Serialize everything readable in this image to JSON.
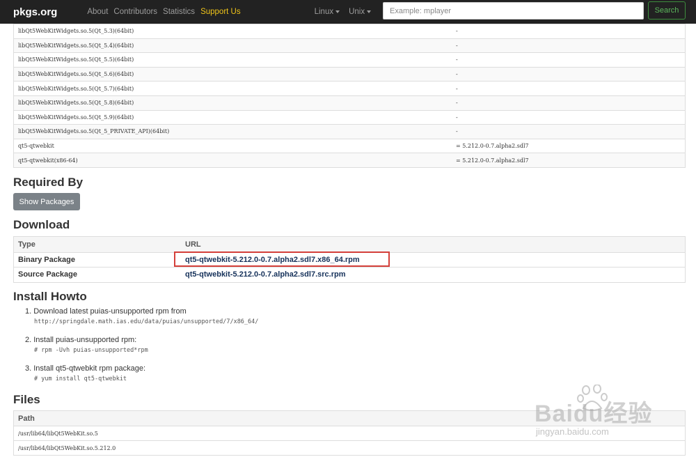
{
  "navbar": {
    "brand": "pkgs.org",
    "links": [
      "About",
      "Contributors",
      "Statistics",
      "Support Us"
    ],
    "dropdowns": [
      "Linux",
      "Unix"
    ],
    "search_placeholder": "Example: mplayer",
    "search_button": "Search",
    "support_color": "#f0c419"
  },
  "provides": [
    {
      "name": "libQt5WebKitWidgets.so.5(Qt_5.3)(64bit)",
      "version": "-"
    },
    {
      "name": "libQt5WebKitWidgets.so.5(Qt_5.4)(64bit)",
      "version": "-"
    },
    {
      "name": "libQt5WebKitWidgets.so.5(Qt_5.5)(64bit)",
      "version": "-"
    },
    {
      "name": "libQt5WebKitWidgets.so.5(Qt_5.6)(64bit)",
      "version": "-"
    },
    {
      "name": "libQt5WebKitWidgets.so.5(Qt_5.7)(64bit)",
      "version": "-"
    },
    {
      "name": "libQt5WebKitWidgets.so.5(Qt_5.8)(64bit)",
      "version": "-"
    },
    {
      "name": "libQt5WebKitWidgets.so.5(Qt_5.9)(64bit)",
      "version": "-"
    },
    {
      "name": "libQt5WebKitWidgets.so.5(Qt_5_PRIVATE_API)(64bit)",
      "version": "-"
    },
    {
      "name": "qt5-qtwebkit",
      "version": "= 5.212.0-0.7.alpha2.sdl7"
    },
    {
      "name": "qt5-qtwebkit(x86-64)",
      "version": "= 5.212.0-0.7.alpha2.sdl7"
    }
  ],
  "required_by": {
    "heading": "Required By",
    "button": "Show Packages"
  },
  "download": {
    "heading": "Download",
    "col_type": "Type",
    "col_url": "URL",
    "rows": [
      {
        "type": "Binary Package",
        "url": "qt5-qtwebkit-5.212.0-0.7.alpha2.sdl7.x86_64.rpm"
      },
      {
        "type": "Source Package",
        "url": "qt5-qtwebkit-5.212.0-0.7.alpha2.sdl7.src.rpm"
      }
    ]
  },
  "howto": {
    "heading": "Install Howto",
    "steps": [
      {
        "title": "1. Download latest puias-unsupported rpm from",
        "code": "http://springdale.math.ias.edu/data/puias/unsupported/7/x86_64/"
      },
      {
        "title": "2. Install puias-unsupported rpm:",
        "code": "# rpm -Uvh puias-unsupported*rpm"
      },
      {
        "title": "3. Install qt5-qtwebkit rpm package:",
        "code": "# yum install qt5-qtwebkit"
      }
    ]
  },
  "files": {
    "heading": "Files",
    "col_path": "Path",
    "rows": [
      "/usr/lib64/libQt5WebKit.so.5",
      "/usr/lib64/libQt5WebKit.so.5.212.0"
    ]
  },
  "watermark": {
    "text": "Baidu经验",
    "sub": "jingyan.baidu.com"
  }
}
